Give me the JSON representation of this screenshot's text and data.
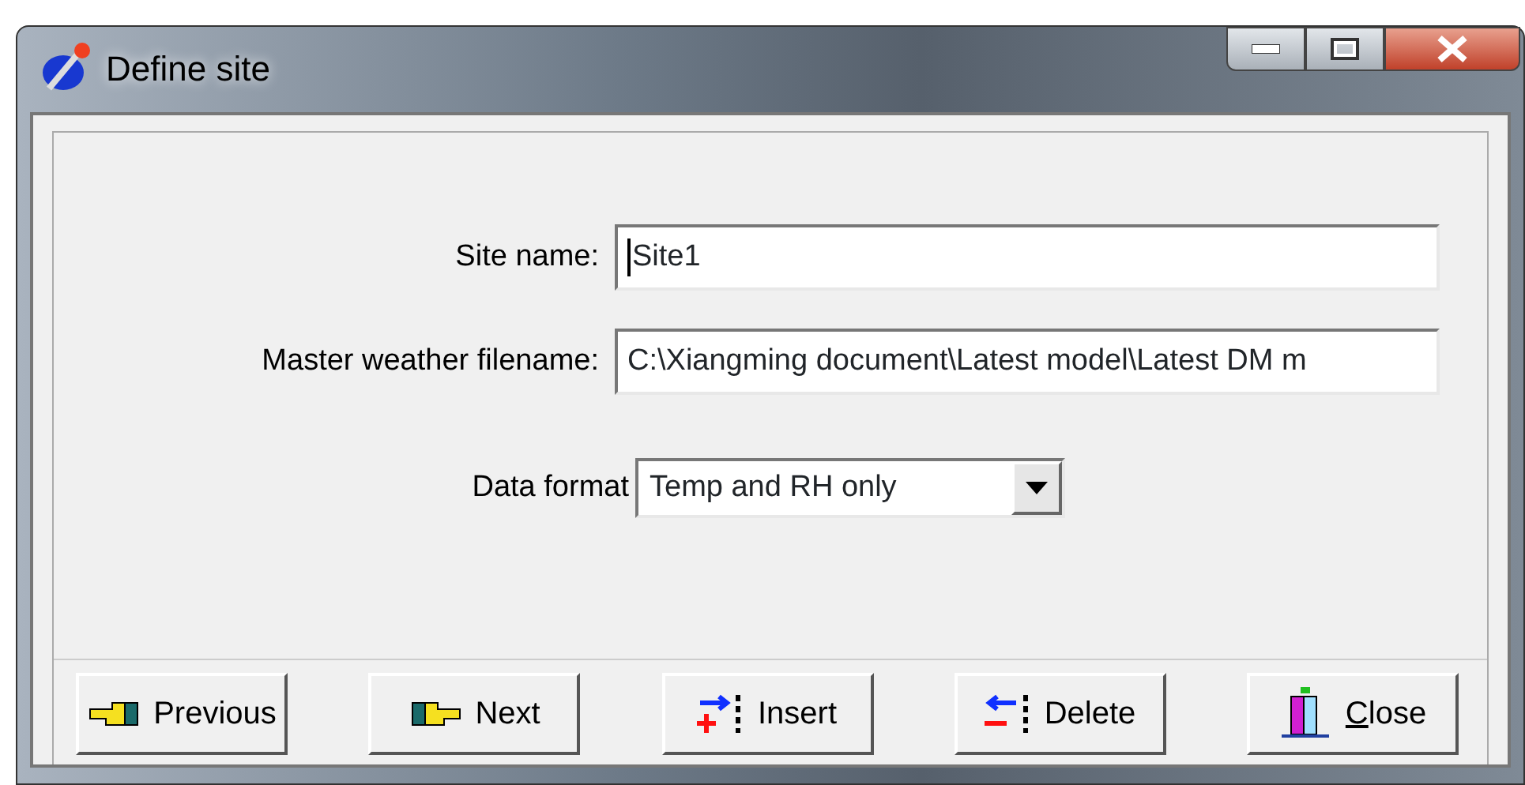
{
  "window": {
    "title": "Define site"
  },
  "fields": [
    {
      "kind": "text",
      "label": "Site name:",
      "value": "Site1",
      "focused": true
    },
    {
      "kind": "text",
      "label": "Master weather filename:",
      "value": "C:\\Xiangming document\\Latest model\\Latest DM m",
      "focused": false
    },
    {
      "kind": "dropdown",
      "label": "Data format",
      "value": "Temp and RH only"
    }
  ],
  "buttons": [
    {
      "kind": "previous",
      "label": "Previous",
      "underline_first": false
    },
    {
      "kind": "next",
      "label": "Next",
      "underline_first": false
    },
    {
      "kind": "insert",
      "label": "Insert",
      "underline_first": false
    },
    {
      "kind": "delete",
      "label": "Delete",
      "underline_first": false
    },
    {
      "kind": "close",
      "label": "Close",
      "underline_first": true
    }
  ]
}
